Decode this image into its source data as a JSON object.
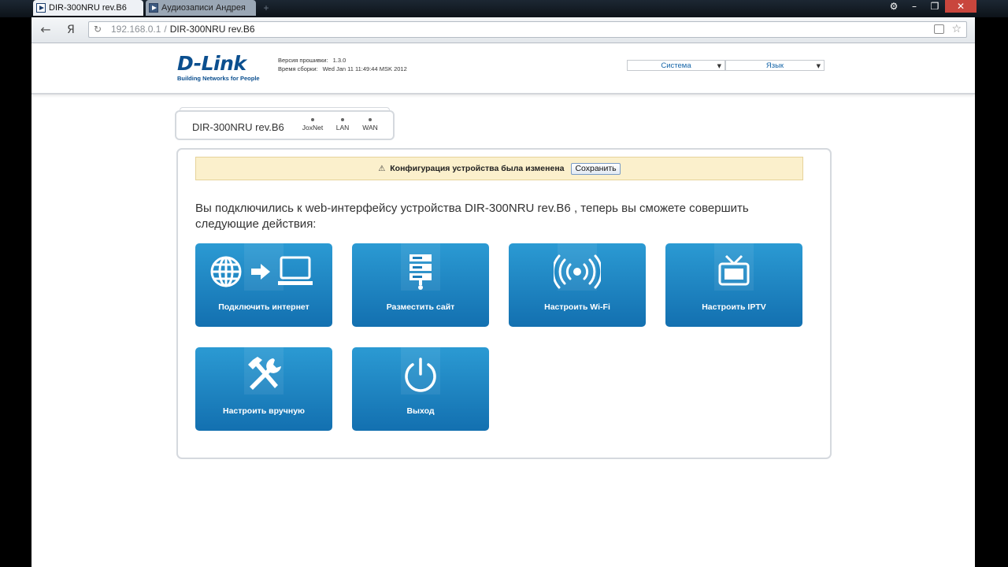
{
  "browser": {
    "tabs": [
      {
        "title": "DIR-300NRU rev.B6",
        "active": true
      },
      {
        "title": "Аудиозаписи Андрея",
        "active": false
      }
    ],
    "back_icon": "←",
    "yandex_icon": "Я",
    "reload_icon": "↻",
    "address": {
      "host": "192.168.0.1",
      "separator": "/",
      "page_title": "DIR-300NRU rev.B6"
    },
    "star_icon": "☆",
    "new_tab_icon": "+",
    "window_controls": {
      "settings": "⚙",
      "minimize": "–",
      "restore": "❐",
      "close": "✕"
    }
  },
  "header": {
    "logo_brand": "D-Link",
    "logo_tagline": "Building Networks for People",
    "firmware_label": "Версия прошивки:",
    "firmware_value": "1.3.0",
    "build_label": "Время сборки:",
    "build_value": "Wed Jan 11 11:49:44 MSK 2012",
    "system_menu": "Система",
    "language_menu": "Язык",
    "caret": "▼"
  },
  "device": {
    "name": "DIR-300NRU rev.B6",
    "indicators": [
      "JoxNet",
      "LAN",
      "WAN"
    ]
  },
  "notice": {
    "icon": "⚠",
    "text": "Конфигурация устройства была изменена",
    "save_button": "Сохранить"
  },
  "intro_text": "Вы подключились к web-интерфейсу устройства DIR-300NRU rev.B6 , теперь вы сможете совершить следующие действия:",
  "tiles": [
    {
      "label": "Подключить интернет",
      "icon": "globe-to-computer-icon"
    },
    {
      "label": "Разместить сайт",
      "icon": "server-icon"
    },
    {
      "label": "Настроить Wi-Fi",
      "icon": "wifi-icon"
    },
    {
      "label": "Настроить IPTV",
      "icon": "tv-icon"
    },
    {
      "label": "Настроить вручную",
      "icon": "tools-icon"
    },
    {
      "label": "Выход",
      "icon": "power-icon"
    }
  ],
  "colors": {
    "tile_top": "#2b9ad3",
    "tile_bottom": "#1370b0",
    "notice_bg": "#fbf0cc",
    "brand": "#0b4f8f"
  }
}
